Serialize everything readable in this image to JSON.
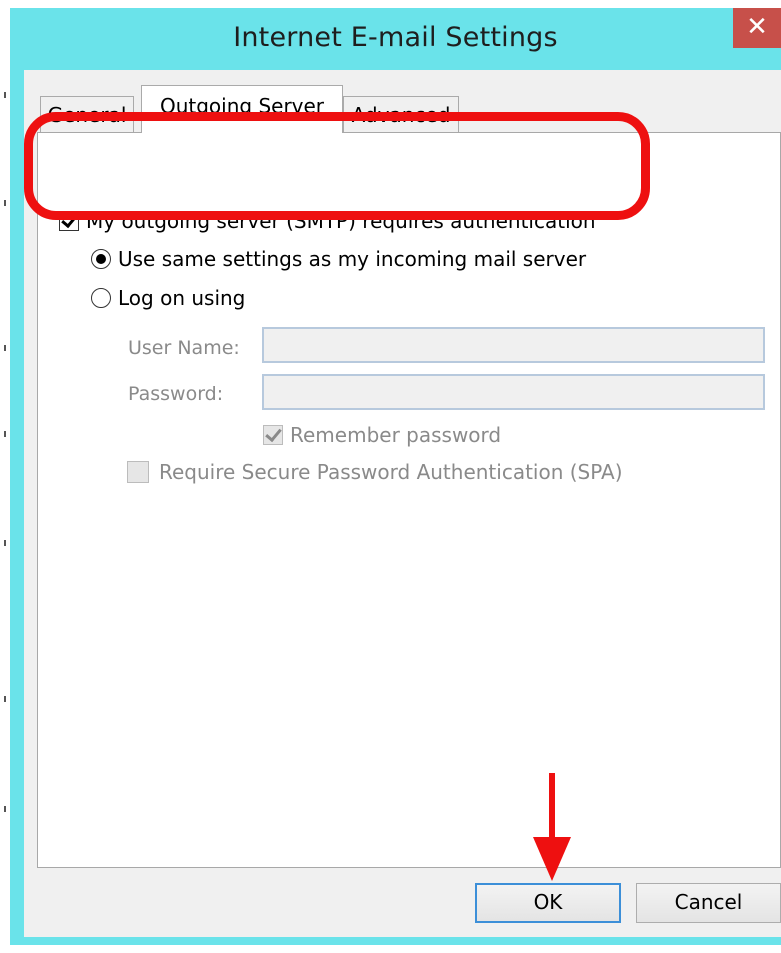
{
  "window": {
    "title": "Internet E-mail Settings",
    "close_label": "✕"
  },
  "tabs": [
    {
      "label": "General",
      "active": false
    },
    {
      "label": "Outgoing Server",
      "active": true
    },
    {
      "label": "Advanced",
      "active": false
    }
  ],
  "outgoing": {
    "smtp_auth_label": "My outgoing server (SMTP) requires authentication",
    "smtp_auth_checked": true,
    "use_same_label": "Use same settings as my incoming mail server",
    "use_same_selected": true,
    "log_on_label": "Log on using",
    "log_on_selected": false,
    "username_label": "User Name:",
    "username_value": "",
    "password_label": "Password:",
    "password_value": "",
    "remember_label": "Remember password",
    "remember_checked": true,
    "spa_label": "Require Secure Password Authentication (SPA)",
    "spa_checked": false
  },
  "buttons": {
    "ok": "OK",
    "cancel": "Cancel"
  },
  "colors": {
    "title_bar": "#6ae3ea",
    "close_button": "#c7504a",
    "highlight": "#ee1010"
  }
}
